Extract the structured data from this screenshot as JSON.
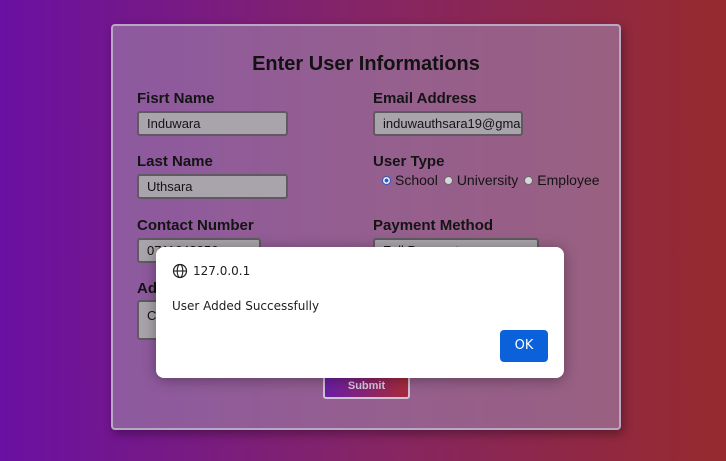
{
  "form": {
    "title": "Enter User Informations",
    "first_name": {
      "label": "Fisrt Name",
      "value": "Induwara"
    },
    "email": {
      "label": "Email Address",
      "value": "induwauthsara19@gma"
    },
    "last_name": {
      "label": "Last Name",
      "value": "Uthsara"
    },
    "user_type": {
      "label": "User Type",
      "options": [
        "School",
        "University",
        "Employee"
      ],
      "selected": "School"
    },
    "contact": {
      "label": "Contact Number",
      "value": "0711643356"
    },
    "payment": {
      "label": "Payment Method",
      "value": "Full Payment"
    },
    "address": {
      "label": "Ad",
      "value": "C"
    },
    "submit_label": "Submit"
  },
  "dialog": {
    "origin": "127.0.0.1",
    "message": "User Added Successfully",
    "ok_label": "OK",
    "ok_color": "#0b61d9"
  },
  "icons": {
    "dialog_origin": "globe-icon"
  }
}
